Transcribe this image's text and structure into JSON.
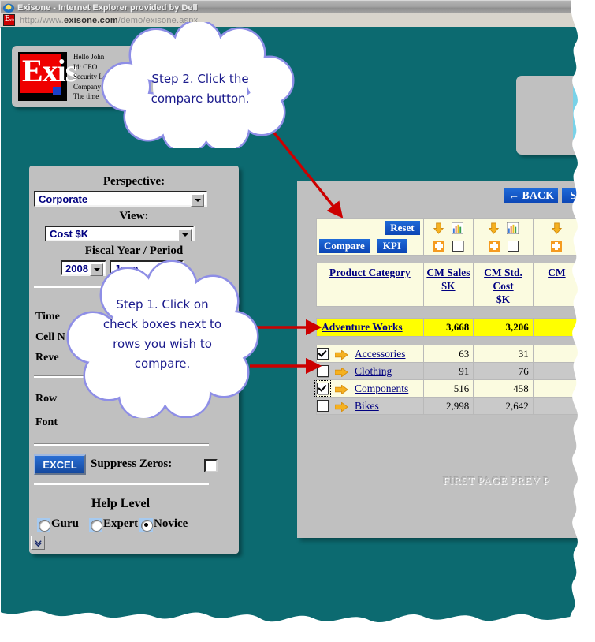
{
  "browser": {
    "title": "Exisone - Internet Explorer provided by Dell",
    "url_prefix": "http://www.",
    "url_domain": "exisone.com",
    "url_path": "/demo/exisone.aspx"
  },
  "app_header": {
    "logo_text": "Exis",
    "info_lines": [
      "Hello John",
      "Id: CEO",
      "Security Level",
      "Company",
      "The time"
    ]
  },
  "sidebar": {
    "perspective_label": "Perspective:",
    "perspective_value": "Corporate",
    "view_label": "View:",
    "view_value": "Cost $K",
    "fiscal_label": "Fiscal Year / Period",
    "fiscal_year": "2008",
    "fiscal_period": "June",
    "options": [
      "Time",
      "Cell N",
      "Reve",
      "Row",
      "Font"
    ],
    "excel_button": "EXCEL",
    "suppress_zeros_label": "Suppress Zeros:",
    "help_level_label": "Help Level",
    "help_levels": [
      {
        "label": "Guru",
        "selected": false
      },
      {
        "label": "Expert",
        "selected": false
      },
      {
        "label": "Novice",
        "selected": true
      }
    ],
    "scroll_glyph": "»"
  },
  "report": {
    "back_button": "← BACK",
    "start_button": "Sta",
    "reset_button": "Reset",
    "compare_button": "Compare",
    "kpi_button": "KPI",
    "columns": [
      "Product Category",
      "CM Sales\n$K",
      "CM Std. Cost\n$K",
      "CM"
    ],
    "total_row": {
      "label": "Adventure Works",
      "values": [
        "3,668",
        "3,206",
        ""
      ]
    },
    "rows": [
      {
        "checked": true,
        "focus": false,
        "label": "Accessories",
        "values": [
          "63",
          "31",
          ""
        ]
      },
      {
        "checked": false,
        "focus": false,
        "label": "Clothing",
        "values": [
          "91",
          "76",
          ""
        ]
      },
      {
        "checked": true,
        "focus": true,
        "label": "Components",
        "values": [
          "516",
          "458",
          ""
        ]
      },
      {
        "checked": false,
        "focus": false,
        "label": "Bikes",
        "values": [
          "2,998",
          "2,642",
          ""
        ]
      }
    ],
    "pager": "FIRST PAGE   PREV P"
  },
  "callouts": [
    {
      "id": "step2",
      "text": "Step 2. Click the\ncompare button."
    },
    {
      "id": "step1",
      "text": "Step 1. Click on\ncheck boxes next to\nrows you wish to\ncompare."
    }
  ],
  "colors": {
    "page_background": "#0c6a70",
    "panel": "#c0c0c0",
    "table_cell": "#fbfbe0",
    "table_alt_row": "#c9c9c9",
    "total_highlight": "#ffff00",
    "link": "#000080",
    "button_blue": "#0c45b4",
    "callout_outline": "#8e8ee6",
    "arrow_red": "#cc0000",
    "icon_orange": "#f59b20",
    "logo_red": "#ef0000"
  }
}
